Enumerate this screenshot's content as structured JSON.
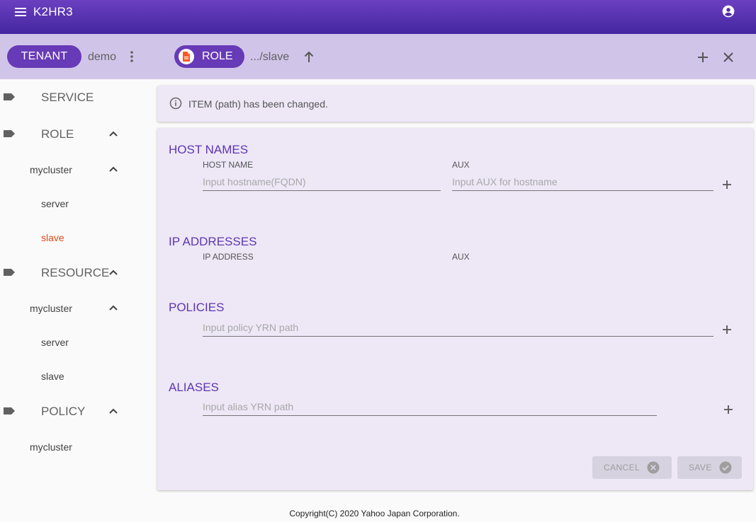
{
  "app": {
    "title": "K2HR3"
  },
  "toolbar": {
    "tenant_label": "TENANT",
    "tenant_name": "demo",
    "role_label": "ROLE",
    "path": ".../slave"
  },
  "sidebar": {
    "service": "SERVICE",
    "role": "ROLE",
    "role_items": {
      "cluster": "mycluster",
      "server": "server",
      "slave": "slave"
    },
    "resource": "RESOURCE",
    "resource_items": {
      "cluster": "mycluster",
      "server": "server",
      "slave": "slave"
    },
    "policy": "POLICY",
    "policy_items": {
      "cluster": "mycluster"
    },
    "selected_color": "#e64a19"
  },
  "banner": {
    "message": "ITEM (path) has been changed."
  },
  "form": {
    "host_names": {
      "title": "HOST NAMES",
      "host_label": "HOST NAME",
      "aux_label": "AUX",
      "host_placeholder": "Input hostname(FQDN)",
      "aux_placeholder": "Input AUX for hostname"
    },
    "ip_addresses": {
      "title": "IP ADDRESSES",
      "ip_label": "IP ADDRESS",
      "aux_label": "AUX"
    },
    "policies": {
      "title": "POLICIES",
      "placeholder": "Input policy YRN path"
    },
    "aliases": {
      "title": "ALIASES",
      "placeholder": "Input alias YRN path"
    },
    "cancel_label": "CANCEL",
    "save_label": "SAVE"
  },
  "footer": {
    "copyright": "Copyright(C) 2020 Yahoo Japan Corporation."
  },
  "colors": {
    "primary": "#673ab7",
    "appbar": "#4527a0",
    "toolbar": "#d1c4e9",
    "card": "#ede7f6",
    "section_title": "#5e35b1",
    "doc_icon": "#ff5722"
  },
  "icons": [
    "menu-icon",
    "account-circle-icon",
    "more-vert-icon",
    "document-icon",
    "arrow-up-icon",
    "add-icon",
    "close-icon",
    "label-icon",
    "chevron-up-icon",
    "info-icon",
    "cancel-circle-icon",
    "check-circle-icon"
  ]
}
